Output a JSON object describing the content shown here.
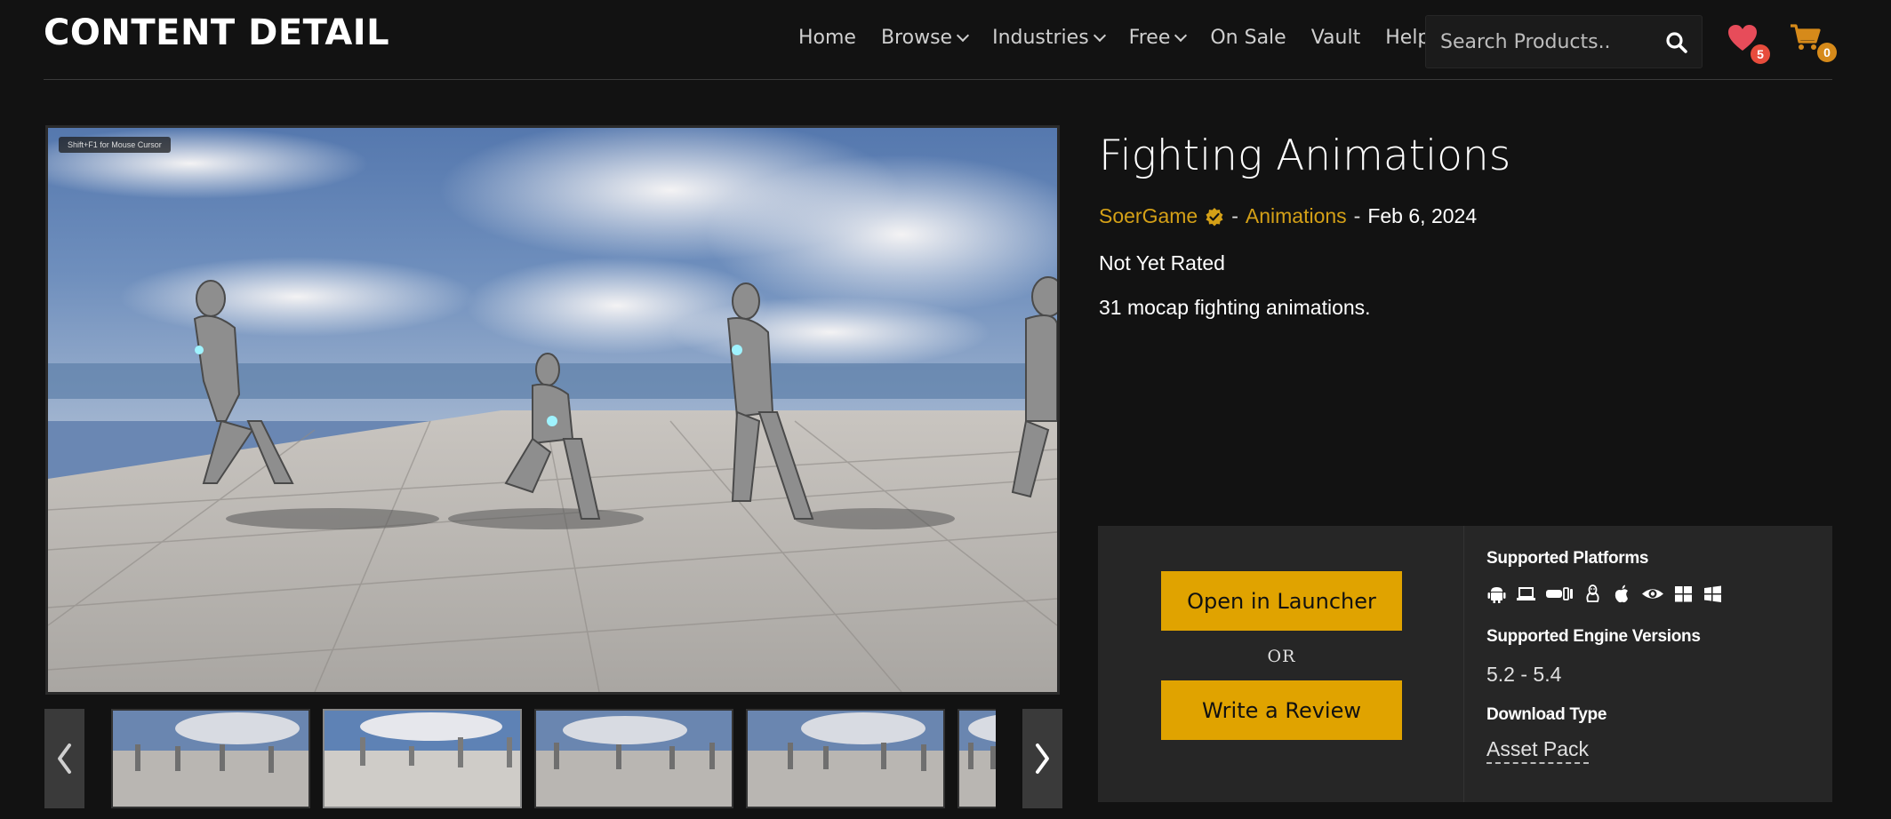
{
  "header": {
    "title": "CONTENT DETAIL",
    "nav": [
      {
        "label": "Home",
        "dropdown": false
      },
      {
        "label": "Browse",
        "dropdown": true
      },
      {
        "label": "Industries",
        "dropdown": true
      },
      {
        "label": "Free",
        "dropdown": true
      },
      {
        "label": "On Sale",
        "dropdown": false
      },
      {
        "label": "Vault",
        "dropdown": false
      },
      {
        "label": "Help",
        "dropdown": false
      }
    ],
    "search": {
      "placeholder": "Search Products..",
      "value": ""
    },
    "wishlist_count": "5",
    "cart_count": "0"
  },
  "gallery": {
    "cursor_hint": "Shift+F1 for Mouse Cursor",
    "thumbnail_count": 5,
    "active_thumbnail": 2
  },
  "product": {
    "title": "Fighting Animations",
    "seller": "SoerGame",
    "separator": "-",
    "category": "Animations",
    "date": "Feb 6, 2024",
    "rating": "Not Yet Rated",
    "description": "31 mocap fighting animations."
  },
  "actions": {
    "open_launcher": "Open in Launcher",
    "or": "OR",
    "write_review": "Write a Review"
  },
  "info": {
    "platforms_label": "Supported Platforms",
    "platforms": [
      "android-icon",
      "laptop-icon",
      "vr-headset-icon",
      "linux-icon",
      "apple-icon",
      "eye-icon",
      "windows-icon",
      "windows-alt-icon"
    ],
    "engine_label": "Supported Engine Versions",
    "engine_versions": "5.2 - 5.4",
    "download_label": "Download Type",
    "download_type": "Asset Pack"
  },
  "colors": {
    "accent": "#e0a300",
    "link": "#d4a017",
    "background": "#121212",
    "panel": "#262626",
    "heart": "#e74c3c",
    "cart": "#d68a1a"
  }
}
